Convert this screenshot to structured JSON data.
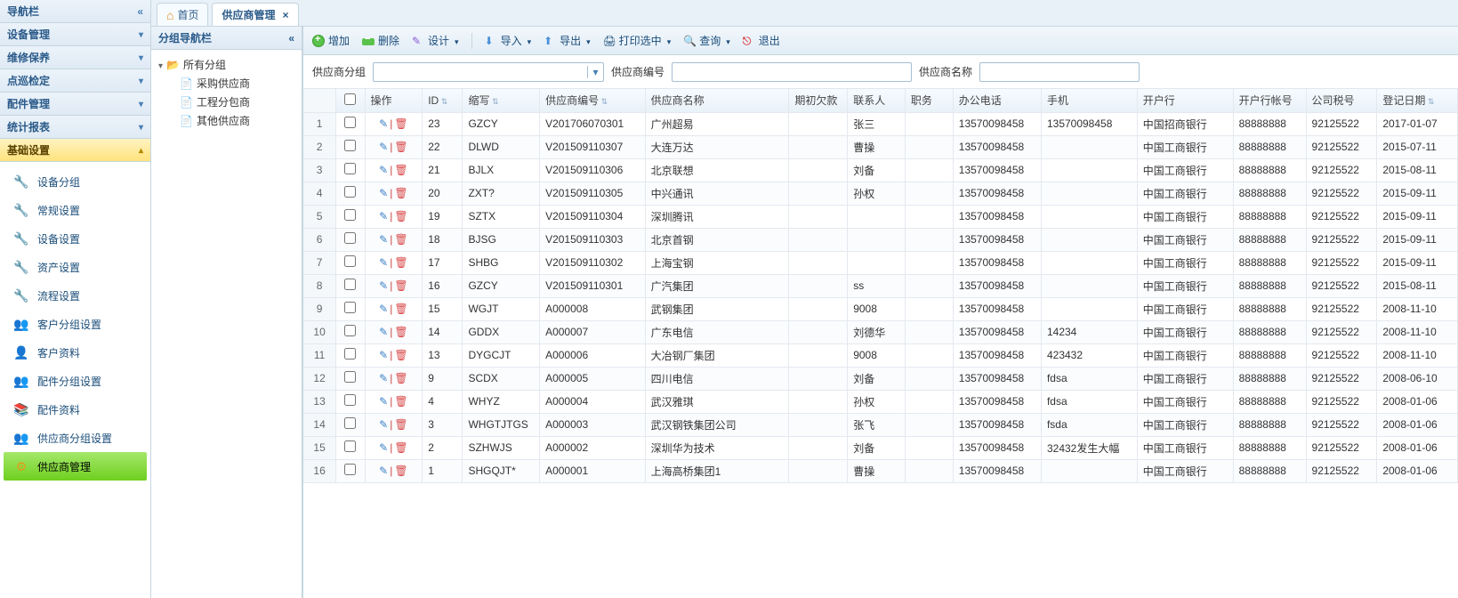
{
  "sidebar": {
    "title": "导航栏",
    "groups": [
      {
        "label": "设备管理",
        "expanded": false
      },
      {
        "label": "维修保养",
        "expanded": false
      },
      {
        "label": "点巡检定",
        "expanded": false
      },
      {
        "label": "配件管理",
        "expanded": false
      },
      {
        "label": "统计报表",
        "expanded": false
      },
      {
        "label": "基础设置",
        "expanded": true
      }
    ],
    "base_items": [
      {
        "label": "设备分组",
        "icon": "wrench"
      },
      {
        "label": "常规设置",
        "icon": "wrench"
      },
      {
        "label": "设备设置",
        "icon": "wrench"
      },
      {
        "label": "资产设置",
        "icon": "wrench"
      },
      {
        "label": "流程设置",
        "icon": "wrench"
      },
      {
        "label": "客户分组设置",
        "icon": "people"
      },
      {
        "label": "客户资料",
        "icon": "person"
      },
      {
        "label": "配件分组设置",
        "icon": "people"
      },
      {
        "label": "配件资料",
        "icon": "books"
      },
      {
        "label": "供应商分组设置",
        "icon": "people"
      },
      {
        "label": "供应商管理",
        "icon": "gear",
        "active": true
      }
    ]
  },
  "tabs": [
    {
      "label": "首页",
      "icon": "home",
      "closable": false,
      "active": false
    },
    {
      "label": "供应商管理",
      "closable": true,
      "active": true
    }
  ],
  "tree": {
    "title": "分组导航栏",
    "root": "所有分组",
    "children": [
      "采购供应商",
      "工程分包商",
      "其他供应商"
    ]
  },
  "toolbar": [
    {
      "label": "增加",
      "icon": "add"
    },
    {
      "label": "删除",
      "icon": "del"
    },
    {
      "label": "设计",
      "icon": "design",
      "dd": true,
      "sep": true
    },
    {
      "label": "导入",
      "icon": "import",
      "dd": true
    },
    {
      "label": "导出",
      "icon": "export",
      "dd": true
    },
    {
      "label": "打印选中",
      "icon": "print",
      "dd": true
    },
    {
      "label": "查询",
      "icon": "search",
      "dd": true
    },
    {
      "label": "退出",
      "icon": "exit"
    }
  ],
  "filters": {
    "group_label": "供应商分组",
    "group_value": "",
    "code_label": "供应商编号",
    "code_value": "",
    "name_label": "供应商名称",
    "name_value": ""
  },
  "columns": [
    {
      "label": "操作",
      "key": "ops"
    },
    {
      "label": "ID",
      "key": "id",
      "sort": true
    },
    {
      "label": "缩写",
      "key": "abbr",
      "sort": true
    },
    {
      "label": "供应商编号",
      "key": "code",
      "sort": true
    },
    {
      "label": "供应商名称",
      "key": "name"
    },
    {
      "label": "期初欠款",
      "key": "debt"
    },
    {
      "label": "联系人",
      "key": "contact"
    },
    {
      "label": "职务",
      "key": "job"
    },
    {
      "label": "办公电话",
      "key": "tel"
    },
    {
      "label": "手机",
      "key": "mobile"
    },
    {
      "label": "开户行",
      "key": "bank"
    },
    {
      "label": "开户行帐号",
      "key": "acct"
    },
    {
      "label": "公司税号",
      "key": "tax"
    },
    {
      "label": "登记日期",
      "key": "date",
      "sort": true
    }
  ],
  "rows": [
    {
      "id": "23",
      "abbr": "GZCY",
      "code": "V201706070301",
      "name": "广州超易",
      "debt": "",
      "contact": "张三",
      "job": "",
      "tel": "13570098458",
      "mobile": "13570098458",
      "bank": "中国招商银行",
      "acct": "88888888",
      "tax": "92125522",
      "date": "2017-01-07"
    },
    {
      "id": "22",
      "abbr": "DLWD",
      "code": "V201509110307",
      "name": "大连万达",
      "debt": "",
      "contact": "曹操",
      "job": "",
      "tel": "13570098458",
      "mobile": "",
      "bank": "中国工商银行",
      "acct": "88888888",
      "tax": "92125522",
      "date": "2015-07-11"
    },
    {
      "id": "21",
      "abbr": "BJLX",
      "code": "V201509110306",
      "name": "北京联想",
      "debt": "",
      "contact": "刘备",
      "job": "",
      "tel": "13570098458",
      "mobile": "",
      "bank": "中国工商银行",
      "acct": "88888888",
      "tax": "92125522",
      "date": "2015-08-11"
    },
    {
      "id": "20",
      "abbr": "ZXT?",
      "code": "V201509110305",
      "name": "中兴通讯",
      "debt": "",
      "contact": "孙权",
      "job": "",
      "tel": "13570098458",
      "mobile": "",
      "bank": "中国工商银行",
      "acct": "88888888",
      "tax": "92125522",
      "date": "2015-09-11"
    },
    {
      "id": "19",
      "abbr": "SZTX",
      "code": "V201509110304",
      "name": "深圳腾讯",
      "debt": "",
      "contact": "",
      "job": "",
      "tel": "13570098458",
      "mobile": "",
      "bank": "中国工商银行",
      "acct": "88888888",
      "tax": "92125522",
      "date": "2015-09-11"
    },
    {
      "id": "18",
      "abbr": "BJSG",
      "code": "V201509110303",
      "name": "北京首钢",
      "debt": "",
      "contact": "",
      "job": "",
      "tel": "13570098458",
      "mobile": "",
      "bank": "中国工商银行",
      "acct": "88888888",
      "tax": "92125522",
      "date": "2015-09-11"
    },
    {
      "id": "17",
      "abbr": "SHBG",
      "code": "V201509110302",
      "name": "上海宝钢",
      "debt": "",
      "contact": "",
      "job": "",
      "tel": "13570098458",
      "mobile": "",
      "bank": "中国工商银行",
      "acct": "88888888",
      "tax": "92125522",
      "date": "2015-09-11"
    },
    {
      "id": "16",
      "abbr": "GZCY",
      "code": "V201509110301",
      "name": "广汽集团",
      "debt": "",
      "contact": "ss",
      "job": "",
      "tel": "13570098458",
      "mobile": "",
      "bank": "中国工商银行",
      "acct": "88888888",
      "tax": "92125522",
      "date": "2015-08-11"
    },
    {
      "id": "15",
      "abbr": "WGJT",
      "code": "A000008",
      "name": "武钢集团",
      "debt": "",
      "contact": "9008",
      "job": "",
      "tel": "13570098458",
      "mobile": "",
      "bank": "中国工商银行",
      "acct": "88888888",
      "tax": "92125522",
      "date": "2008-11-10"
    },
    {
      "id": "14",
      "abbr": "GDDX",
      "code": "A000007",
      "name": "广东电信",
      "debt": "",
      "contact": "刘德华",
      "job": "",
      "tel": "13570098458",
      "mobile": "14234",
      "bank": "中国工商银行",
      "acct": "88888888",
      "tax": "92125522",
      "date": "2008-11-10"
    },
    {
      "id": "13",
      "abbr": "DYGCJT",
      "code": "A000006",
      "name": "大冶钢厂集团",
      "debt": "",
      "contact": "9008",
      "job": "",
      "tel": "13570098458",
      "mobile": "423432",
      "bank": "中国工商银行",
      "acct": "88888888",
      "tax": "92125522",
      "date": "2008-11-10"
    },
    {
      "id": "9",
      "abbr": "SCDX",
      "code": "A000005",
      "name": "四川电信",
      "debt": "",
      "contact": "刘备",
      "job": "",
      "tel": "13570098458",
      "mobile": "fdsa",
      "bank": "中国工商银行",
      "acct": "88888888",
      "tax": "92125522",
      "date": "2008-06-10"
    },
    {
      "id": "4",
      "abbr": "WHYZ",
      "code": "A000004",
      "name": "武汉雅琪",
      "debt": "",
      "contact": "孙权",
      "job": "",
      "tel": "13570098458",
      "mobile": "fdsa",
      "bank": "中国工商银行",
      "acct": "88888888",
      "tax": "92125522",
      "date": "2008-01-06"
    },
    {
      "id": "3",
      "abbr": "WHGTJTGS",
      "code": "A000003",
      "name": "武汉钢铁集团公司",
      "debt": "",
      "contact": "张飞",
      "job": "",
      "tel": "13570098458",
      "mobile": "fsda",
      "bank": "中国工商银行",
      "acct": "88888888",
      "tax": "92125522",
      "date": "2008-01-06"
    },
    {
      "id": "2",
      "abbr": "SZHWJS",
      "code": "A000002",
      "name": "深圳华为技术",
      "debt": "",
      "contact": "刘备",
      "job": "",
      "tel": "13570098458",
      "mobile": "32432发生大幅",
      "bank": "中国工商银行",
      "acct": "88888888",
      "tax": "92125522",
      "date": "2008-01-06"
    },
    {
      "id": "1",
      "abbr": "SHGQJT*",
      "code": "A000001",
      "name": "上海高桥集团1",
      "debt": "",
      "contact": "曹操",
      "job": "",
      "tel": "13570098458",
      "mobile": "",
      "bank": "中国工商银行",
      "acct": "88888888",
      "tax": "92125522",
      "date": "2008-01-06"
    }
  ]
}
